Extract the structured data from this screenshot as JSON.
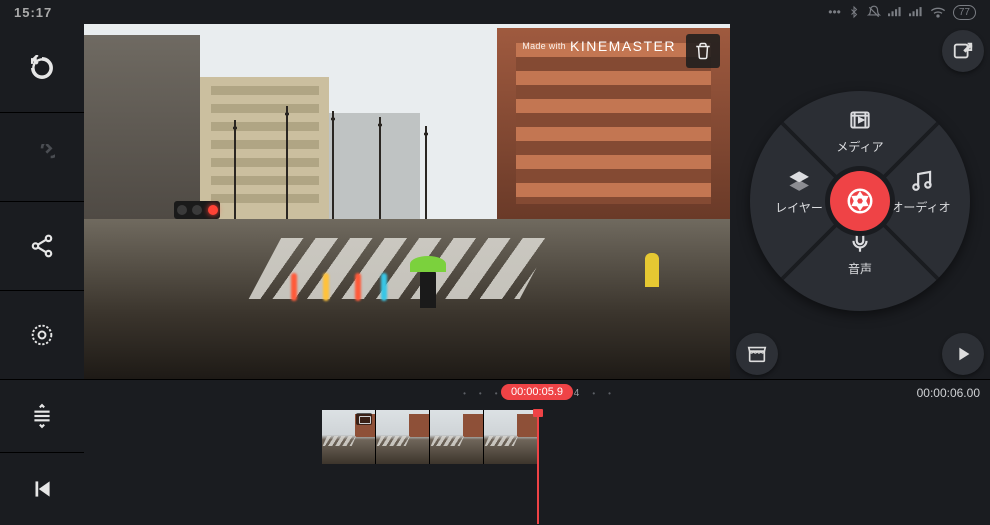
{
  "status": {
    "time": "15:17",
    "battery": "77"
  },
  "watermark": {
    "prefix": "Made with",
    "brand": "KINEMASTER"
  },
  "wheel": {
    "media": "メディア",
    "layer": "レイヤー",
    "audio": "オーディオ",
    "voice": "音声"
  },
  "timeline": {
    "current_time": "00:00:05.9",
    "duration": "00:00:06.00",
    "frame_indicator": "4"
  }
}
